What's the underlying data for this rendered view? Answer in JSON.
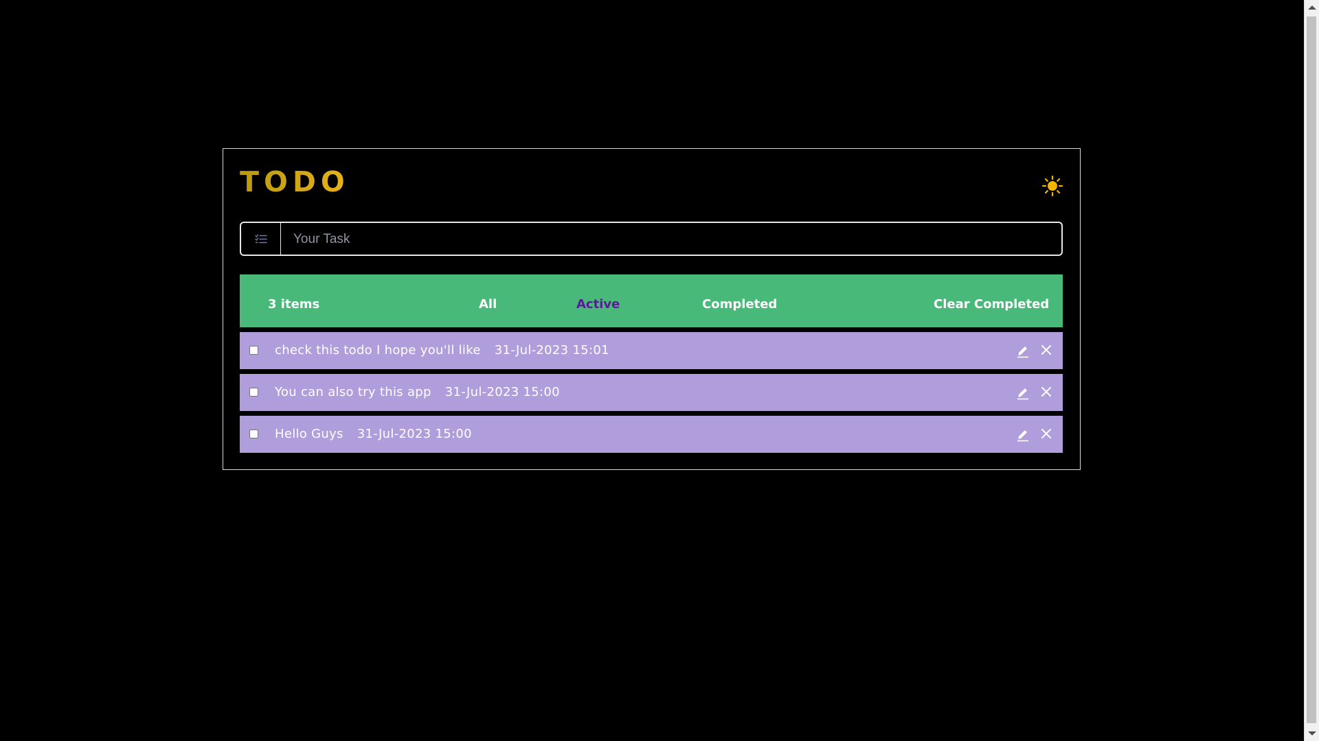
{
  "app": {
    "title": "TODO",
    "theme_toggle_icon": "sun-icon"
  },
  "task_input": {
    "placeholder": "Your Task",
    "value": "",
    "icon": "checklist-icon"
  },
  "filter_bar": {
    "items_count": "3 items",
    "all_label": "All",
    "active_label": "Active",
    "completed_label": "Completed",
    "clear_label": "Clear Completed",
    "selected": "Active"
  },
  "todos": [
    {
      "text": "check this todo I hope you'll like",
      "date": "31-Jul-2023 15:01",
      "checked": false
    },
    {
      "text": "You can also try this app",
      "date": "31-Jul-2023 15:00",
      "checked": false
    },
    {
      "text": "Hello Guys",
      "date": "31-Jul-2023 15:00",
      "checked": false
    }
  ],
  "colors": {
    "background": "#000000",
    "title_gold": "#c9a310",
    "filter_bar": "#48b978",
    "active_filter": "#5b1a9a",
    "todo_item": "#b09ddb",
    "sun": "#f5b400"
  }
}
